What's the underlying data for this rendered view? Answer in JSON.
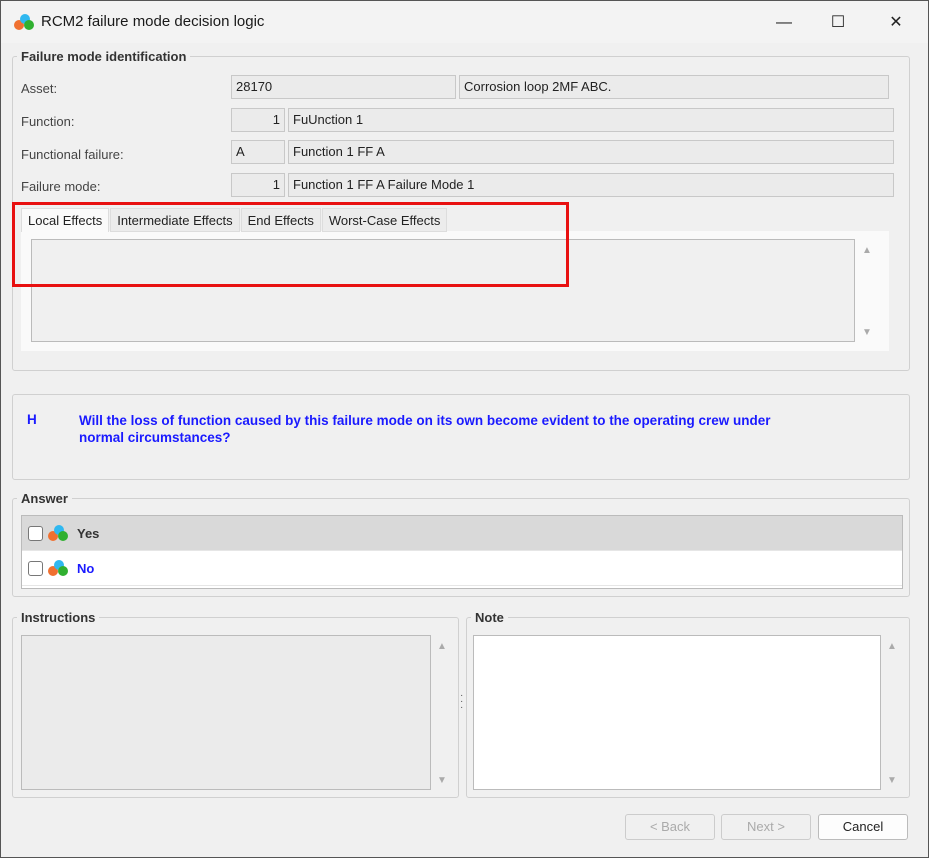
{
  "window": {
    "title": "RCM2 failure mode decision logic",
    "min": "—",
    "max": "☐",
    "close": "✕"
  },
  "identification": {
    "legend": "Failure mode identification",
    "asset_label": "Asset:",
    "asset_code": "28170",
    "asset_name": "Corrosion loop 2MF ABC.",
    "function_label": "Function:",
    "function_no": "1",
    "function_name": "FuUnction 1",
    "ff_label": "Functional failure:",
    "ff_code": "A",
    "ff_name": "Function 1 FF A",
    "fm_label": "Failure mode:",
    "fm_no": "1",
    "fm_name": "Function 1 FF A Failure Mode 1"
  },
  "tabs": [
    "Local Effects",
    "Intermediate Effects",
    "End Effects",
    "Worst-Case Effects"
  ],
  "question": {
    "code": "H",
    "text": "Will the loss of function caused by this failure mode on its own become evident to the operating crew under normal circumstances?"
  },
  "answer": {
    "legend": "Answer",
    "options": [
      {
        "label": "Yes",
        "checked": false
      },
      {
        "label": "No",
        "checked": false
      }
    ]
  },
  "instructions": {
    "legend": "Instructions"
  },
  "note": {
    "legend": "Note"
  },
  "buttons": {
    "back": "< Back",
    "next": "Next >",
    "cancel": "Cancel"
  },
  "colors": {
    "highlight": "#e81010",
    "question": "#1a1aff"
  }
}
